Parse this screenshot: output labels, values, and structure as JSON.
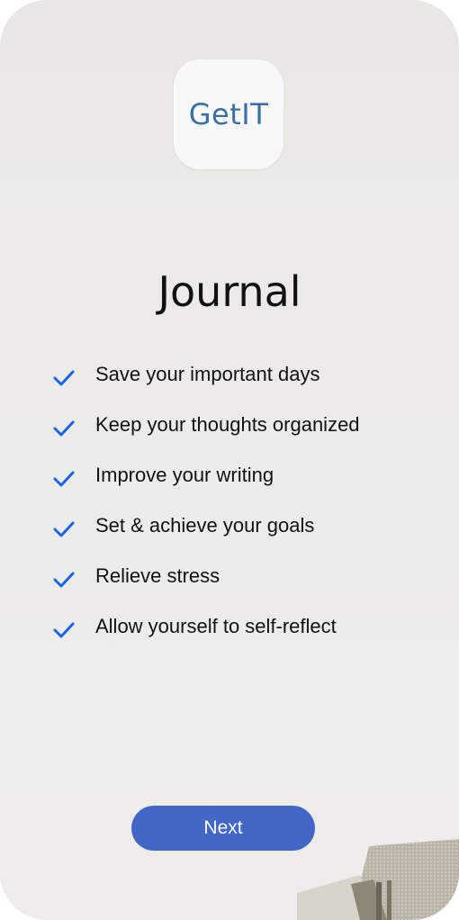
{
  "app": {
    "logo_text": "GetIT"
  },
  "screen": {
    "title": "Journal"
  },
  "features": [
    {
      "label": "Save your important days",
      "icon": "check-icon"
    },
    {
      "label": "Keep your thoughts organized",
      "icon": "check-icon"
    },
    {
      "label": "Improve your writing",
      "icon": "check-icon"
    },
    {
      "label": "Set & achieve your goals",
      "icon": "check-icon"
    },
    {
      "label": "Relieve stress",
      "icon": "check-icon"
    },
    {
      "label": "Allow yourself to self-reflect",
      "icon": "check-icon"
    }
  ],
  "actions": {
    "next_label": "Next"
  },
  "colors": {
    "accent": "#4267c7",
    "check": "#1a63e6",
    "logo": "#3a6ea5"
  }
}
